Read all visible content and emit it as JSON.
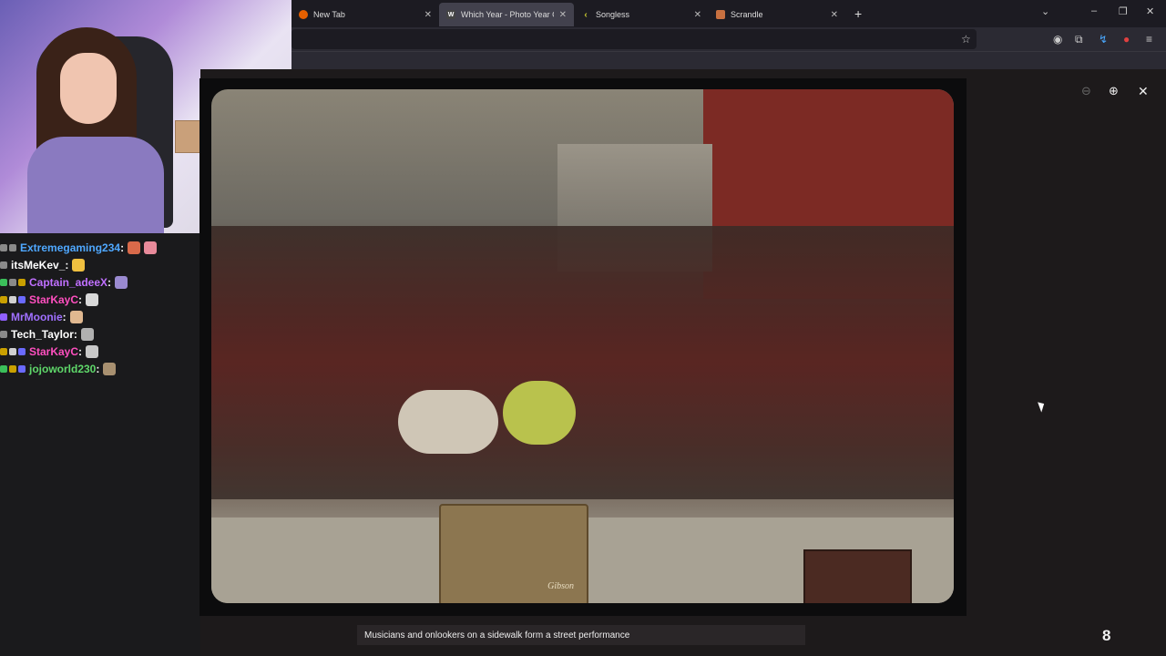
{
  "browser": {
    "tabs": [
      {
        "label": "New Tab",
        "icon": "firefox-icon",
        "color": "#e66000",
        "active": false
      },
      {
        "label": "Which Year - Photo Year Guess",
        "icon": "wy-icon",
        "color": "#444444",
        "active": true
      },
      {
        "label": "Songless",
        "icon": "songless-icon",
        "color": "#c8c830",
        "active": false
      },
      {
        "label": "Scrandle",
        "icon": "scrandle-icon",
        "color": "#c87040",
        "active": false
      }
    ],
    "new_tab_glyph": "+"
  },
  "chat": [
    {
      "user": "Extremegaming234",
      "color": "#4fa8ff",
      "badges": [
        "#8a8a8a",
        "#8a8a8a"
      ]
    },
    {
      "user": "itsMeKev_",
      "color": "#ffffff",
      "badges": [
        "#8a8a8a"
      ]
    },
    {
      "user": "Captain_adeeX",
      "color": "#c070ff",
      "badges": [
        "#3bbf5a",
        "#8a8a8a",
        "#c9a000"
      ]
    },
    {
      "user": "StarKayC",
      "color": "#ff4fbf",
      "badges": [
        "#c9a000",
        "#d0d0d0",
        "#6a6aff"
      ]
    },
    {
      "user": "MrMoonie",
      "color": "#a070ff",
      "badges": [
        "#9060ff"
      ]
    },
    {
      "user": "Tech_Taylor",
      "color": "#ffffff",
      "badges": [
        "#8a8a8a"
      ]
    },
    {
      "user": "StarKayC",
      "color": "#ff4fbf",
      "badges": [
        "#c9a000",
        "#d0d0d0",
        "#6a6aff"
      ]
    },
    {
      "user": "jojoworld230",
      "color": "#5fd86a",
      "badges": [
        "#3bbf5a",
        "#c9a000",
        "#6a6aff"
      ]
    }
  ],
  "chat_colon": ":",
  "lightbox": {
    "caption": "Musicians and onlookers on a sidewalk form a street performance",
    "counter": "8",
    "amp_brand": "Gibson"
  }
}
